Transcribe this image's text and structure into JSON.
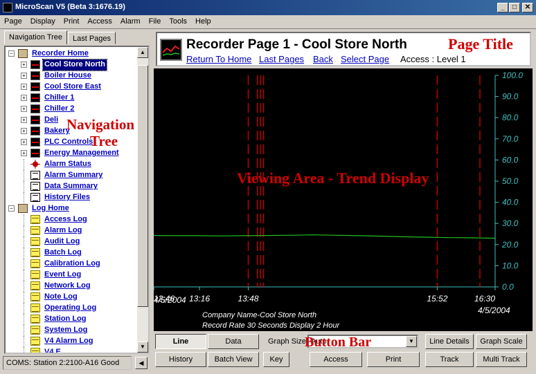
{
  "app": {
    "title": "MicroScan V5 (Beta 3:1676.19)"
  },
  "window_buttons": {
    "minimize": "_",
    "maximize": "□",
    "close": "✕"
  },
  "menu": [
    "Page",
    "Display",
    "Print",
    "Access",
    "Alarm",
    "File",
    "Tools",
    "Help"
  ],
  "tabs": {
    "nav_tree": "Navigation Tree",
    "last_pages": "Last Pages"
  },
  "tree": {
    "recorder_home": "Recorder Home",
    "recorder_items": [
      "Cool Store North",
      "Boiler House",
      "Cool Store East",
      "Chiller 1",
      "Chiller 2",
      "Deli",
      "Bakery",
      "PLC Controls",
      "Energy Management"
    ],
    "status_items": [
      "Alarm Status",
      "Alarm Summary",
      "Data Summary",
      "History Files"
    ],
    "log_home": "Log Home",
    "log_items": [
      "Access Log",
      "Alarm Log",
      "Audit Log",
      "Batch Log",
      "Calibration Log",
      "Event Log",
      "Network Log",
      "Note Log",
      "Operating Log",
      "Station Log",
      "System Log",
      "V4 Alarm Log",
      "V4 E..."
    ]
  },
  "status_bar": {
    "text": "COMS: Station 2:2100-A16 Good"
  },
  "header": {
    "title": "Recorder Page 1 - Cool Store North",
    "links": [
      "Return To Home",
      "Last Pages",
      "Back",
      "Select Page"
    ],
    "access": "Access : Level 1"
  },
  "annotations": {
    "page_title": "Page Title",
    "navigation_tree_1": "Navigation",
    "navigation_tree_2": "Tree",
    "viewing_area": "Viewing Area - Trend Display",
    "button_bar": "Button Bar"
  },
  "trend": {
    "y_ticks": [
      "100.0",
      "90.0",
      "80.0",
      "70.0",
      "60.0",
      "50.0",
      "40.0",
      "30.0",
      "20.0",
      "10.0",
      "0.0"
    ],
    "x_ticks": [
      "12:46",
      "13:16",
      "13:48",
      "15:52",
      "16:30"
    ],
    "date_left": "4/5/2004",
    "date_right": "4/5/2004",
    "footer_line1": "Company Name-Cool Store North",
    "footer_line2": "Record Rate 30 Seconds Display 2 Hour",
    "colors": {
      "background": "#000000",
      "axis": "#40c0c0",
      "trace": "#20c020",
      "events": "#c00000"
    }
  },
  "chart_data": {
    "type": "line",
    "title": "",
    "xlabel": "",
    "ylabel": "",
    "ylim": [
      0,
      100
    ],
    "x_tick_labels": [
      "12:46",
      "13:16",
      "13:48",
      "15:52",
      "16:30"
    ],
    "series": [
      {
        "values": [
          24.3,
          24.2,
          24.2,
          24.1,
          24.2,
          24.3,
          24.4,
          24.6,
          24.4,
          24.2,
          24.0,
          23.7,
          23.5,
          23.3,
          23.2,
          23.0
        ]
      }
    ],
    "event_markers": [
      "13:48",
      "13:54",
      "13:56",
      "13:58",
      "15:52",
      "16:20"
    ],
    "grid": false
  },
  "buttons": {
    "line": "Line",
    "data": "Data",
    "graph_size_label": "Graph Size",
    "graph_size_value": "Auto",
    "line_details": "Line Details",
    "graph_scale": "Graph Scale",
    "history": "History",
    "batch_view": "Batch View",
    "key": "Key",
    "access": "Access",
    "print": "Print",
    "track": "Track",
    "multi_track": "Multi Track"
  }
}
